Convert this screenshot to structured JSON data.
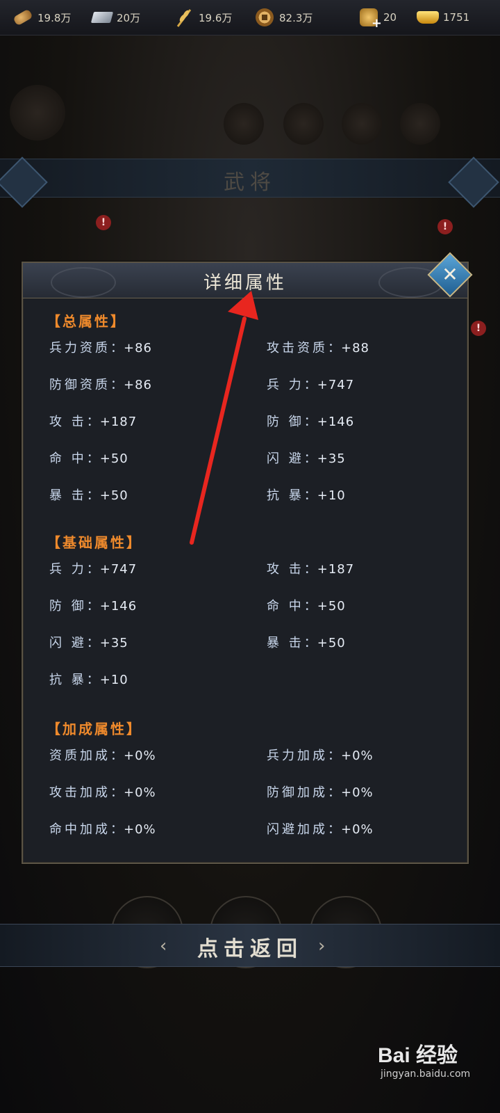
{
  "resources": [
    {
      "icon": "wood-icon",
      "value": "19.8万"
    },
    {
      "icon": "iron-icon",
      "value": "20万"
    },
    {
      "icon": "grain-icon",
      "value": "19.6万"
    },
    {
      "icon": "copper-coin-icon",
      "value": "82.3万"
    },
    {
      "icon": "token-icon",
      "value": "20"
    },
    {
      "icon": "gold-ingot-icon",
      "value": "1751"
    }
  ],
  "background": {
    "panel_title": "武将"
  },
  "modal": {
    "title": "详细属性",
    "sections": [
      {
        "title": "【总属性】",
        "rows": [
          [
            {
              "label": "兵力资质",
              "value": "+86"
            },
            {
              "label": "攻击资质",
              "value": "+88"
            }
          ],
          [
            {
              "label": "防御资质",
              "value": "+86"
            },
            {
              "label": "兵 力",
              "value": "+747"
            }
          ],
          [
            {
              "label": "攻 击",
              "value": "+187"
            },
            {
              "label": "防 御",
              "value": "+146"
            }
          ],
          [
            {
              "label": "命 中",
              "value": "+50"
            },
            {
              "label": "闪 避",
              "value": "+35"
            }
          ],
          [
            {
              "label": "暴 击",
              "value": "+50"
            },
            {
              "label": "抗 暴",
              "value": "+10"
            }
          ]
        ]
      },
      {
        "title": "【基础属性】",
        "rows": [
          [
            {
              "label": "兵 力",
              "value": "+747"
            },
            {
              "label": "攻 击",
              "value": "+187"
            }
          ],
          [
            {
              "label": "防 御",
              "value": "+146"
            },
            {
              "label": "命 中",
              "value": "+50"
            }
          ],
          [
            {
              "label": "闪 避",
              "value": "+35"
            },
            {
              "label": "暴 击",
              "value": "+50"
            }
          ],
          [
            {
              "label": "抗 暴",
              "value": "+10"
            }
          ]
        ]
      },
      {
        "title": "【加成属性】",
        "rows": [
          [
            {
              "label": "资质加成",
              "value": "+0%"
            },
            {
              "label": "兵力加成",
              "value": "+0%"
            }
          ],
          [
            {
              "label": "攻击加成",
              "value": "+0%"
            },
            {
              "label": "防御加成",
              "value": "+0%"
            }
          ],
          [
            {
              "label": "命中加成",
              "value": "+0%"
            },
            {
              "label": "闪避加成",
              "value": "+0%"
            }
          ]
        ]
      }
    ],
    "separator": "："
  },
  "return_bar": {
    "label": "点击返回"
  },
  "watermark": {
    "main": "Bai 经验",
    "sub": "jingyan.baidu.com"
  },
  "colors": {
    "section_title": "#ef8a2c",
    "attr_text": "#c9d7ec",
    "arrow": "#e8261f"
  }
}
